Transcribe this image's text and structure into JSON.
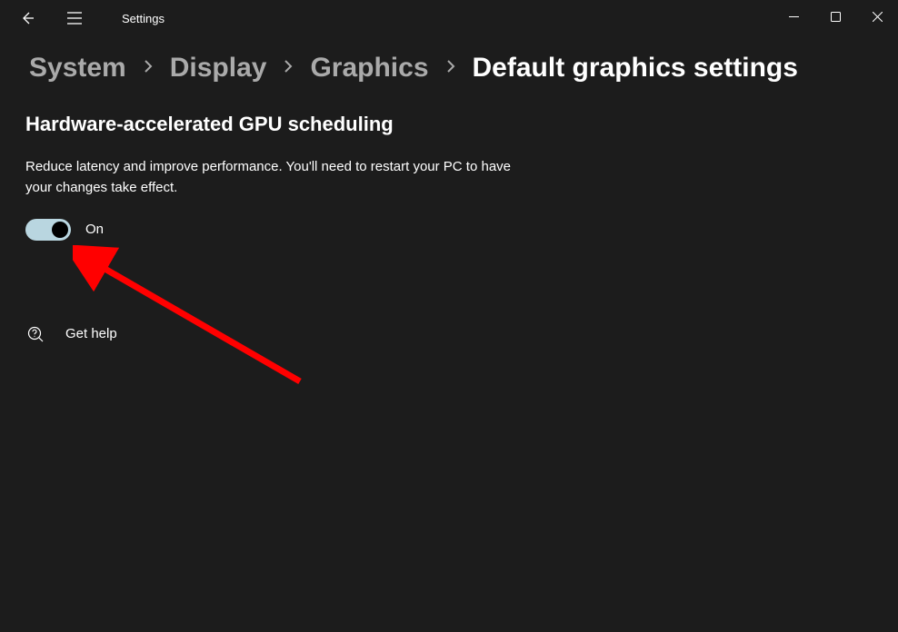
{
  "app": {
    "title": "Settings"
  },
  "breadcrumb": {
    "items": [
      "System",
      "Display",
      "Graphics"
    ],
    "current": "Default graphics settings"
  },
  "section": {
    "title": "Hardware-accelerated GPU scheduling",
    "description": "Reduce latency and improve performance. You'll need to restart your PC to have your changes take effect.",
    "toggle_state": "On"
  },
  "help": {
    "label": "Get help"
  }
}
